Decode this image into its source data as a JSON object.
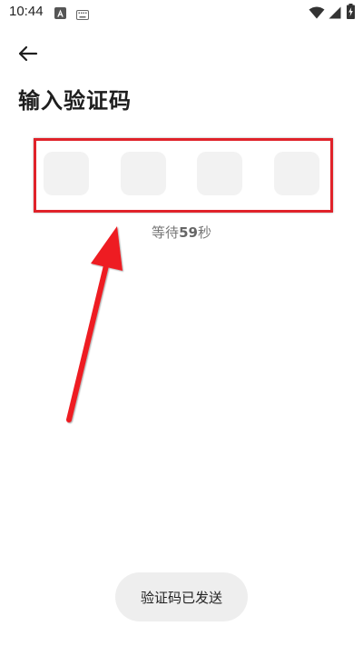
{
  "status_bar": {
    "time": "10:44",
    "icons": [
      "assistant-a-icon",
      "keyboard-icon",
      "wifi-icon",
      "signal-icon",
      "battery-charging-icon"
    ]
  },
  "header": {
    "back_icon": "arrow-left-icon",
    "title": "输入验证码"
  },
  "code_input": {
    "length": 4,
    "digits": [
      "",
      "",
      "",
      ""
    ],
    "highlight_color": "#e0222a"
  },
  "countdown": {
    "prefix": "等待",
    "seconds": "59",
    "suffix": "秒"
  },
  "toast": {
    "message": "验证码已发送"
  },
  "annotation": {
    "arrow_color": "#ee1c24"
  }
}
